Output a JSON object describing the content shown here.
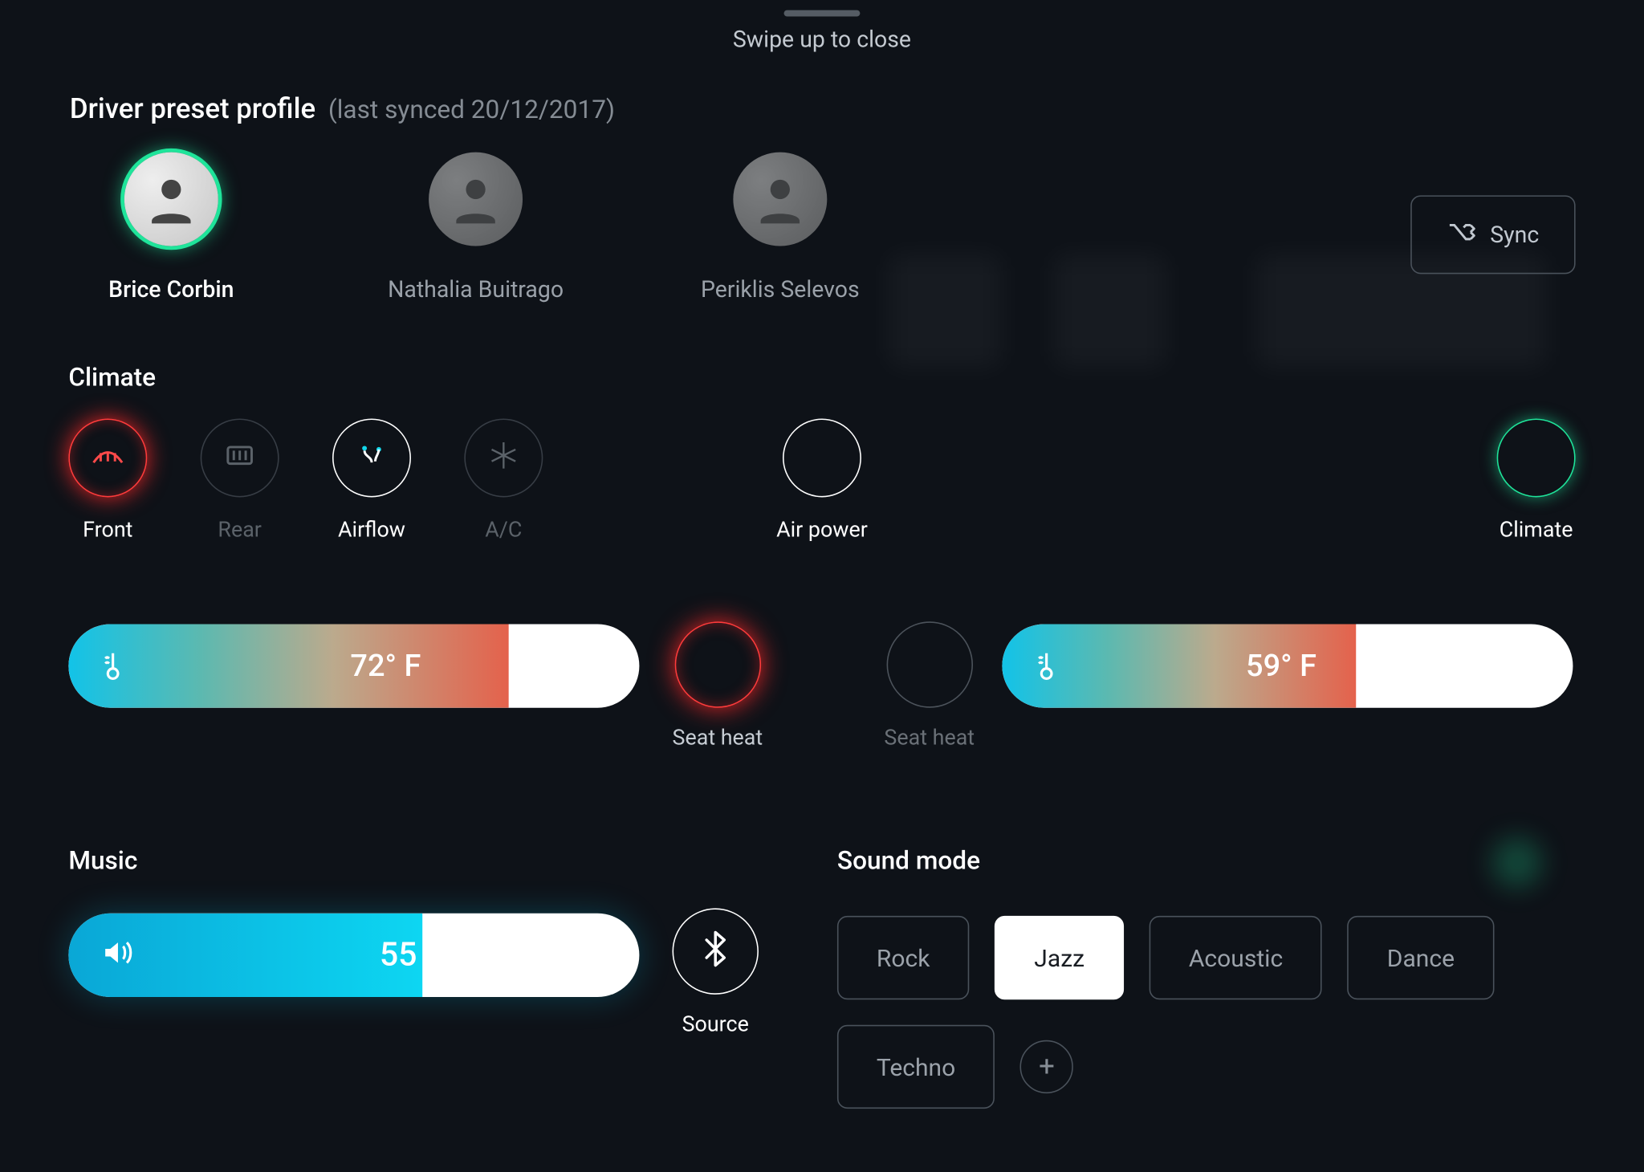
{
  "swipe_hint": "Swipe up to close",
  "preset": {
    "title": "Driver preset profile",
    "last_synced_label": "(last synced 20/12/2017)"
  },
  "profiles": [
    {
      "name": "Brice Corbin",
      "active": true
    },
    {
      "name": "Nathalia Buitrago",
      "active": false
    },
    {
      "name": "Periklis Selevos",
      "active": false
    }
  ],
  "sync_button": "Sync",
  "climate": {
    "section_label": "Climate",
    "controls": {
      "front": "Front",
      "rear": "Rear",
      "airflow": "Airflow",
      "ac": "A/C"
    },
    "air_power": "Air power",
    "power_label": "Climate",
    "temp_left": "72° F",
    "temp_right": "59° F",
    "seat_heat_left": "Seat heat",
    "seat_heat_right": "Seat heat"
  },
  "music": {
    "section_label": "Music",
    "volume": "55",
    "source_label": "Source"
  },
  "sound": {
    "section_label": "Sound mode",
    "modes": [
      "Rock",
      "Jazz",
      "Acoustic",
      "Dance",
      "Techno"
    ],
    "active_mode": "Jazz"
  }
}
